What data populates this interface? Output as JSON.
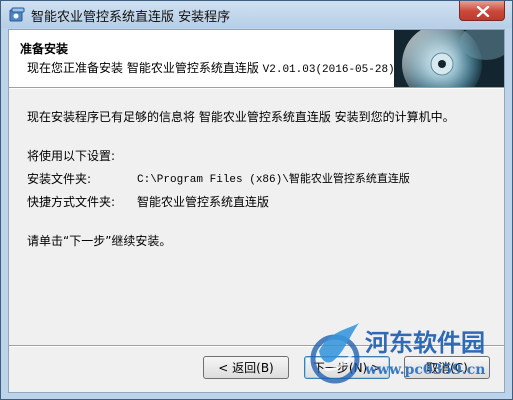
{
  "window": {
    "title": "智能农业管控系统直连版 安装程序",
    "icons": {
      "app": "installer-app-icon",
      "close": "close-icon"
    }
  },
  "header": {
    "title": "准备安装",
    "subtitle_prefix": "现在您正准备安装 智能农业管控系统直连版 ",
    "subtitle_version": "V2.01.03(2016-05-28)",
    "image": "cd-disc-banner"
  },
  "body": {
    "intro": "现在安装程序已有足够的信息将 智能农业管控系统直连版 安装到您的计算机中。",
    "settings_heading": "将使用以下设置:",
    "install_folder_label": "安装文件夹:",
    "install_folder_value": "C:\\Program Files (x86)\\智能农业管控系统直连版",
    "shortcut_folder_label": "快捷方式文件夹:",
    "shortcut_folder_value": "智能农业管控系统直连版",
    "instruction": "请单击“下一步”继续安装。"
  },
  "buttons": {
    "back": "< 返回(B)",
    "next": "下一步(N) >",
    "cancel": "取消(C)"
  },
  "watermark": {
    "name": "河东软件园",
    "url": "www.pc0359.cn"
  },
  "colors": {
    "titlebar": "#bcd3ea",
    "close_button": "#c9483a",
    "dialog_background": "#f0f0f0",
    "watermark": "#1e5fb0"
  }
}
